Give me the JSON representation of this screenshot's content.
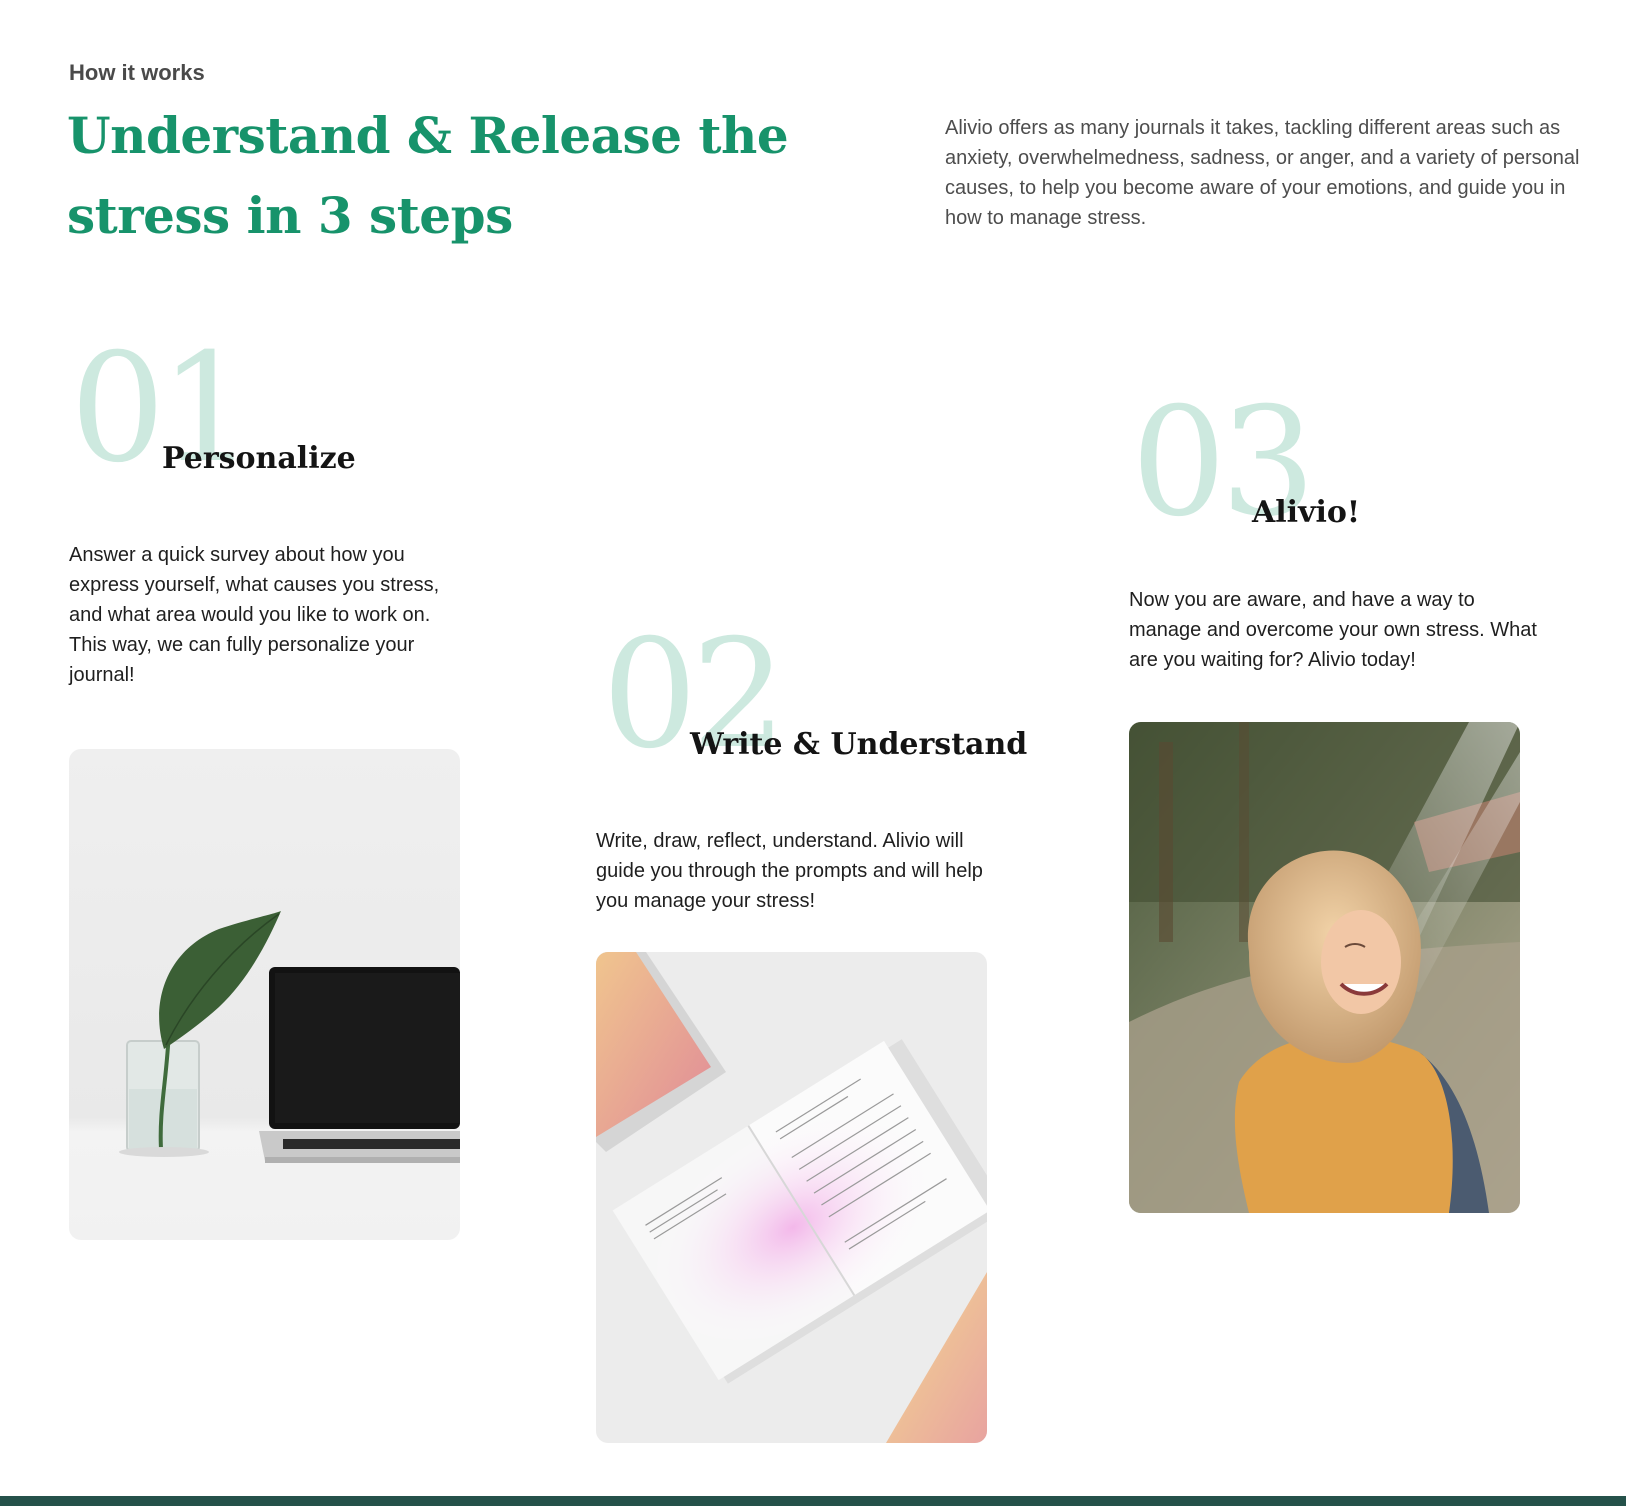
{
  "section": {
    "eyebrow": "How it works",
    "headline": "Understand & Release the stress in 3 steps",
    "intro": "Alivio offers as many journals it takes, tackling different areas such as anxiety, overwhelmedness, sadness, or anger, and a variety of personal causes, to help you become aware of your emotions, and guide you in how to manage stress."
  },
  "steps": [
    {
      "number": "01",
      "title": "Personalize",
      "description": "Answer a quick survey about how you express yourself, what causes you stress, and what area would you like to work on. This way, we can fully personalize your journal!",
      "image": "laptop-and-plant-photo"
    },
    {
      "number": "02",
      "title": "Write & Understand",
      "description": "Write, draw, reflect, understand. Alivio will guide you through the prompts and will help you manage your stress!",
      "image": "open-journal-photo"
    },
    {
      "number": "03",
      "title": "Alivio!",
      "description": "Now you are aware, and have a way to manage and overcome your own stress. What are you waiting for? Alivio today!",
      "image": "smiling-woman-photo"
    }
  ],
  "colors": {
    "accent": "#17936b",
    "step_number": "#cde9df",
    "footer_bar": "#25514a",
    "text": "#1f1f1f",
    "muted_text": "#4d4d4d"
  }
}
